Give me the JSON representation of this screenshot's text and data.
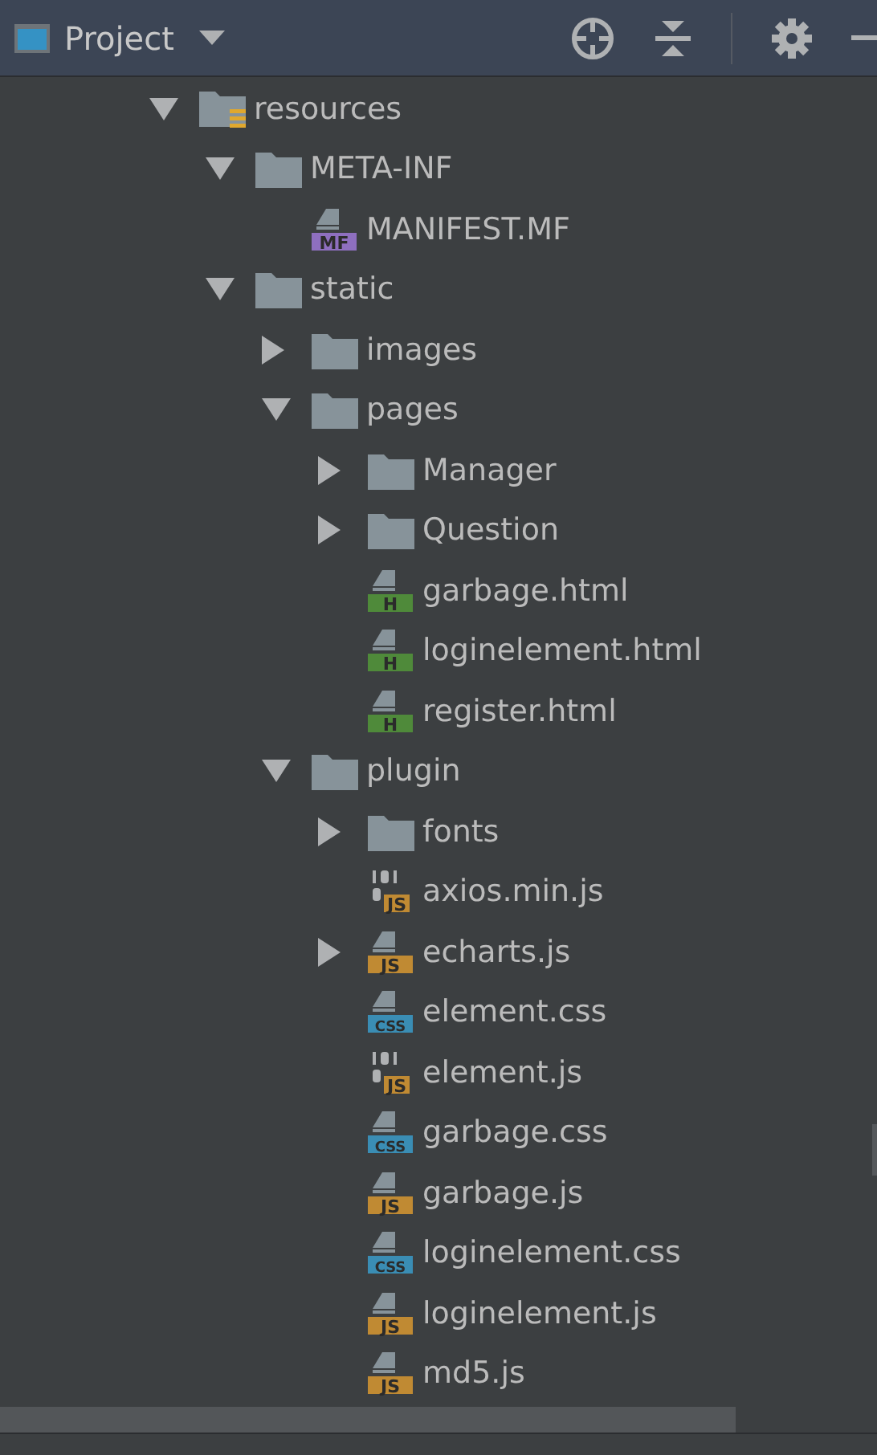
{
  "header": {
    "title": "Project"
  },
  "tree": [
    {
      "label": "resources",
      "kind": "resources",
      "expanded": true,
      "children": [
        {
          "label": "META-INF",
          "kind": "folder",
          "expanded": true,
          "children": [
            {
              "label": "MANIFEST.MF",
              "kind": "file",
              "badge": "MF",
              "color": "#8e6fbf"
            }
          ]
        },
        {
          "label": "static",
          "kind": "folder",
          "expanded": true,
          "children": [
            {
              "label": "images",
              "kind": "folder",
              "expanded": false
            },
            {
              "label": "pages",
              "kind": "folder",
              "expanded": true,
              "children": [
                {
                  "label": "Manager",
                  "kind": "folder",
                  "expanded": false
                },
                {
                  "label": "Question",
                  "kind": "folder",
                  "expanded": false
                },
                {
                  "label": "garbage.html",
                  "kind": "file",
                  "badge": "H",
                  "color": "#4f8a3a"
                },
                {
                  "label": "loginelement.html",
                  "kind": "file",
                  "badge": "H",
                  "color": "#4f8a3a"
                },
                {
                  "label": "register.html",
                  "kind": "file",
                  "badge": "H",
                  "color": "#4f8a3a"
                }
              ]
            },
            {
              "label": "plugin",
              "kind": "folder",
              "expanded": true,
              "children": [
                {
                  "label": "fonts",
                  "kind": "folder",
                  "expanded": false
                },
                {
                  "label": "axios.min.js",
                  "kind": "binary",
                  "badge": "JS",
                  "color": "#c08a33"
                },
                {
                  "label": "echarts.js",
                  "kind": "file",
                  "badge": "JS",
                  "color": "#c08a33",
                  "expanded": false
                },
                {
                  "label": "element.css",
                  "kind": "file",
                  "badge": "CSS",
                  "color": "#3a8db4"
                },
                {
                  "label": "element.js",
                  "kind": "binary",
                  "badge": "JS",
                  "color": "#c08a33"
                },
                {
                  "label": "garbage.css",
                  "kind": "file",
                  "badge": "CSS",
                  "color": "#3a8db4"
                },
                {
                  "label": "garbage.js",
                  "kind": "file",
                  "badge": "JS",
                  "color": "#c08a33"
                },
                {
                  "label": "loginelement.css",
                  "kind": "file",
                  "badge": "CSS",
                  "color": "#3a8db4"
                },
                {
                  "label": "loginelement.js",
                  "kind": "file",
                  "badge": "JS",
                  "color": "#c08a33"
                },
                {
                  "label": "md5.js",
                  "kind": "file",
                  "badge": "JS",
                  "color": "#c08a33"
                }
              ]
            }
          ]
        }
      ]
    }
  ]
}
